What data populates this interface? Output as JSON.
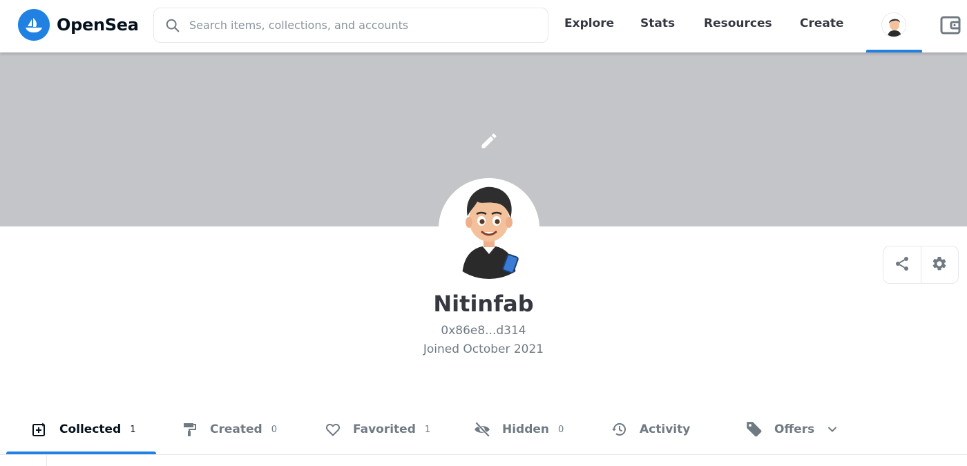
{
  "header": {
    "brand_name": "OpenSea",
    "search_placeholder": "Search items, collections, and accounts",
    "nav": {
      "explore": "Explore",
      "stats": "Stats",
      "resources": "Resources",
      "create": "Create"
    },
    "icons": [
      "opensea-logo-icon",
      "search-icon",
      "avatar",
      "wallet-icon"
    ]
  },
  "banner": {
    "color": "#c4c5c8",
    "edit_icon": "pencil-icon"
  },
  "profile": {
    "name": "Nitinfab",
    "address": "0x86e8...d314",
    "joined": "Joined October 2021",
    "actions": [
      "share-icon",
      "gear-icon"
    ]
  },
  "tabs": [
    {
      "label": "Collected",
      "count": "1",
      "icon": "collected-icon",
      "active": true
    },
    {
      "label": "Created",
      "count": "0",
      "icon": "paint-roller-icon",
      "active": false
    },
    {
      "label": "Favorited",
      "count": "1",
      "icon": "heart-icon",
      "active": false
    },
    {
      "label": "Hidden",
      "count": "0",
      "icon": "eye-off-icon",
      "active": false
    },
    {
      "label": "Activity",
      "count": "",
      "icon": "history-icon",
      "active": false
    },
    {
      "label": "Offers",
      "count": "",
      "icon": "tag-icon",
      "active": false
    }
  ],
  "colors": {
    "accent": "#2081e2",
    "text_primary": "#353840",
    "text_secondary": "#707a83",
    "border": "#e5e8eb"
  }
}
